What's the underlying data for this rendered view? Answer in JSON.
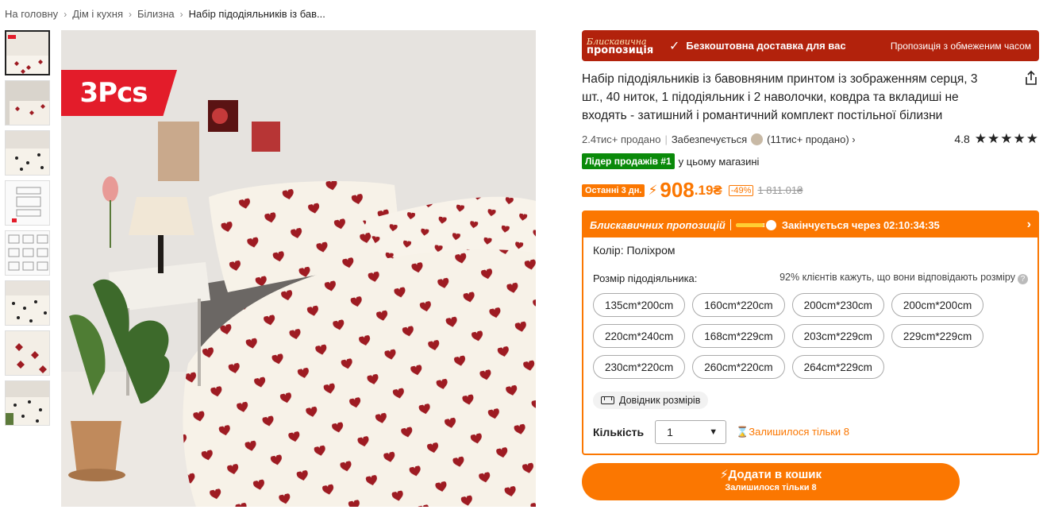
{
  "breadcrumb": [
    "На головну",
    "Дім і кухня",
    "Білизна",
    "Набір підодіяльників із бав..."
  ],
  "banner": {
    "logo_line1": "Блискавична",
    "logo_line2": "пропозиція",
    "free_shipping": "Безкоштовна доставка для вас",
    "limited_offer": "Пропозиція з обмеженим часом"
  },
  "product": {
    "badge": "3Pcs",
    "title": "Набір підодіяльників із бавовняним принтом із зображенням серця, 3 шт., 40 ниток, 1 підодіяльник і 2 наволочки, ковдра та вкладиші не входять - затишний і романтичний комплект постільної білизни",
    "sold": "2.4тис+ продано",
    "secured_by": "Забезпечується",
    "store_sold": "(11тис+ продано)",
    "rating": "4.8",
    "stars": "★★★★★",
    "leader_badge": "Лідер продажів #1",
    "leader_text": "у цьому магазині"
  },
  "price": {
    "last_days": "Останні 3 дн.",
    "main": "908",
    "decimals": ".19₴",
    "discount": "-49%",
    "old": "1 811.01₴"
  },
  "flash": {
    "name": "Блискавичних пропозицій",
    "ends_in": "Закінчується через 02:10:34:35",
    "timer_progress": 0.8
  },
  "options": {
    "color_label": "Колір: Поліхром",
    "size_label": "Розмір підодіяльника:",
    "fit_note": "92% клієнтів кажуть, що вони відповідають розміру",
    "size_rows": [
      [
        "135cm*200cm",
        "160cm*220cm",
        "200cm*230cm",
        "200cm*200cm"
      ],
      [
        "220cm*240cm",
        "168cm*229cm",
        "203cm*229cm",
        "229cm*229cm"
      ],
      [
        "230cm*220cm",
        "260cm*220cm",
        "264cm*229cm"
      ]
    ],
    "size_guide": "Довідник розмірів",
    "qty_label": "Кількість",
    "qty_value": "1",
    "stock_left": "Залишилося тільки 8"
  },
  "cart": {
    "label": "Додати в кошик",
    "sub": "Залишилося тільки 8"
  },
  "colors": {
    "accent": "#fb7701",
    "flash_red": "#b2220c",
    "leader_green": "#0a8a0a",
    "heart_red": "#9e1b22"
  }
}
